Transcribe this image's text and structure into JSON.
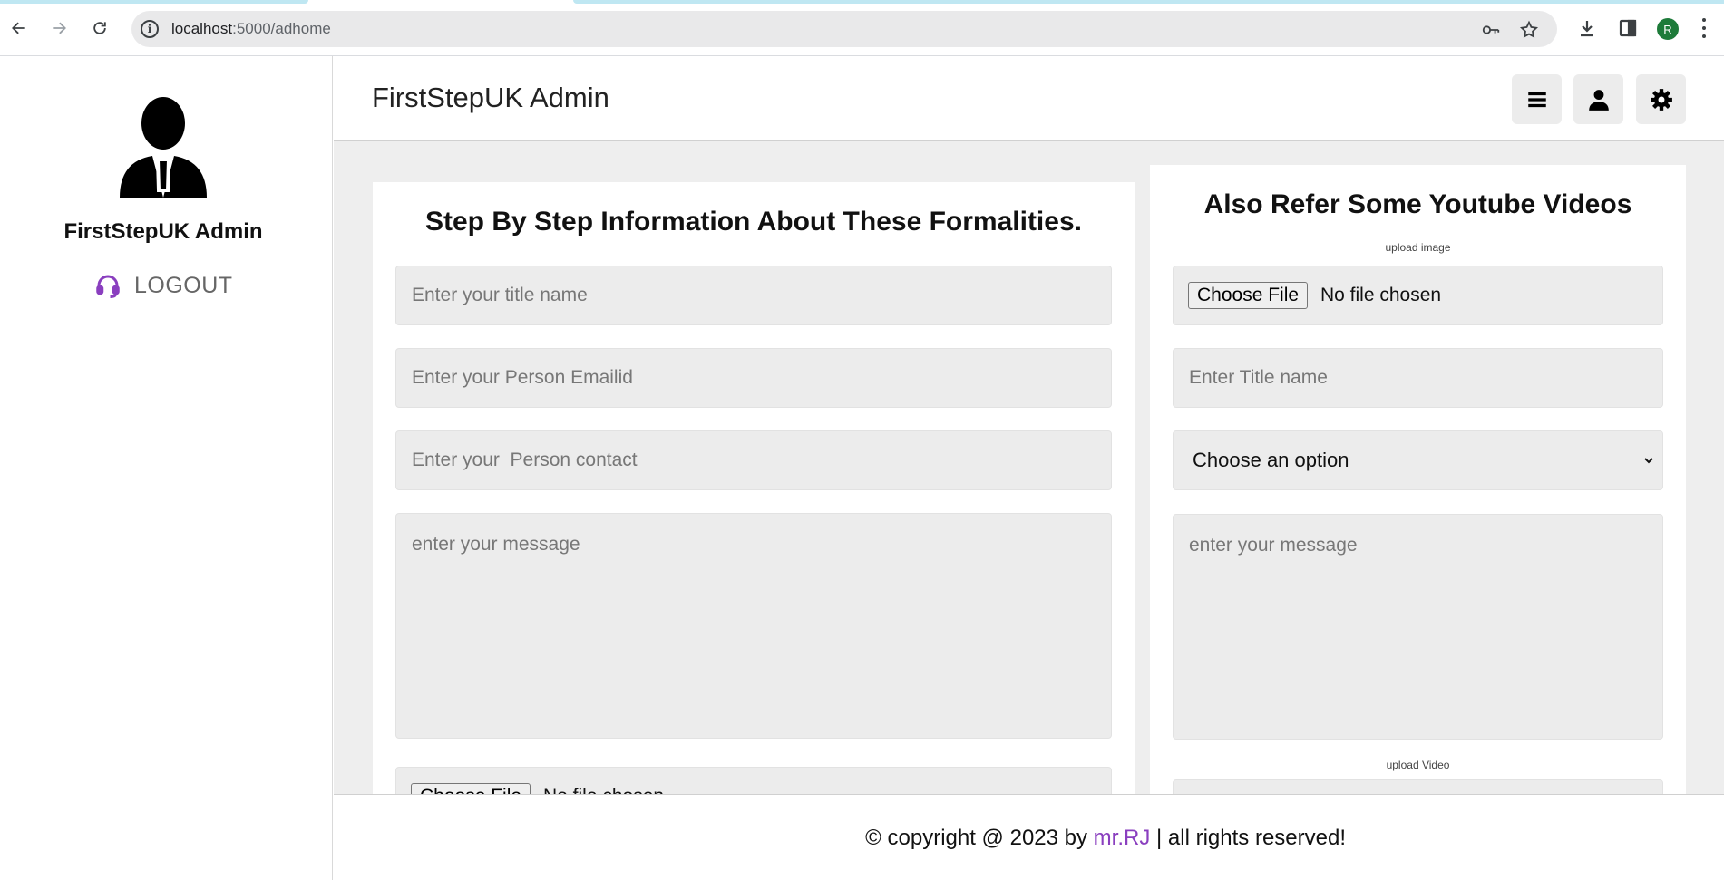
{
  "browser": {
    "url_host": "localhost",
    "url_path": ":5000/adhome",
    "profile_initial": "R"
  },
  "sidebar": {
    "admin_name": "FirstStepUK Admin",
    "logout_label": "LOGOUT"
  },
  "topbar": {
    "title": "FirstStepUK Admin"
  },
  "left_form": {
    "title": "Step By Step Information About These Formalities.",
    "title_placeholder": "Enter your title name",
    "email_placeholder": "Enter your Person Emailid",
    "contact_placeholder": "Enter your  Person contact",
    "message_placeholder": "enter your message",
    "file_button": "Choose File",
    "file_status": "No file chosen"
  },
  "right_form": {
    "title": "Also Refer Some Youtube Videos",
    "upload_image_label": "upload image",
    "file_button": "Choose File",
    "file_status": "No file chosen",
    "title_placeholder": "Enter Title name",
    "select_value": "Choose an option",
    "message_placeholder": "enter your message",
    "upload_video_label": "upload Video"
  },
  "footer": {
    "prefix": "© copyright @ 2023 by ",
    "brand": "mr.RJ",
    "suffix": " | all rights reserved!"
  },
  "colors": {
    "accent": "#8a3fbf",
    "panel_bg": "#eeeeee",
    "field_bg": "#ececec"
  }
}
